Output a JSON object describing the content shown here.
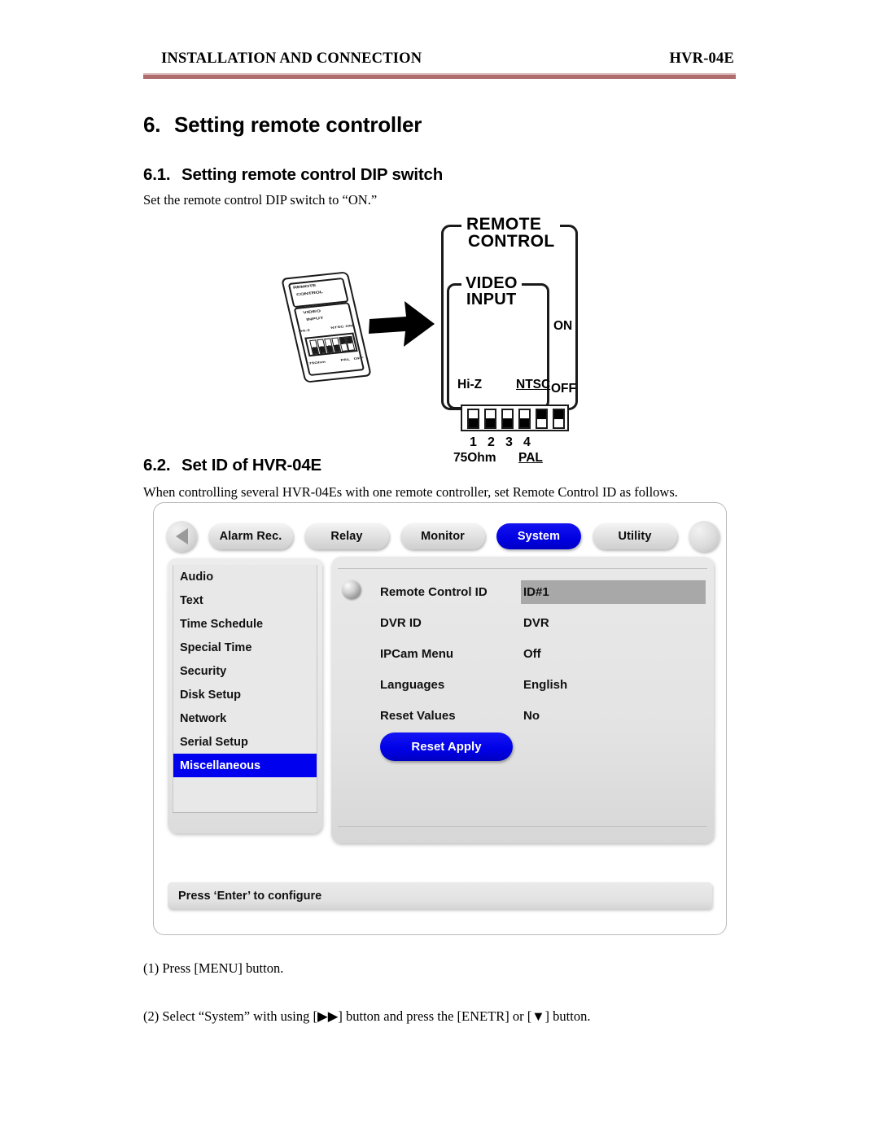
{
  "header": {
    "left": "INSTALLATION AND CONNECTION",
    "right": "HVR-04E",
    "rule_color": "#b06d6d"
  },
  "sections": {
    "s6": {
      "number": "6.",
      "title": "Setting remote controller"
    },
    "s61": {
      "number": "6.1.",
      "title": "Setting remote control DIP switch",
      "body": "Set the remote control DIP switch to “ON.”"
    },
    "s62": {
      "number": "6.2.",
      "title": "Set ID of HVR-04E",
      "body": "When controlling several HVR-04Es with one remote controller, set Remote Control ID as follows."
    }
  },
  "dip_figure": {
    "outer_legend_line1": "REMOTE",
    "outer_legend_line2": "CONTROL",
    "inner_legend_line1": "VIDEO",
    "inner_legend_line2": "INPUT",
    "label_hiz": "Hi-Z",
    "label_ntsc": "NTSC",
    "label_on": "ON",
    "label_off": "OFF",
    "label_75ohm": "75Ohm",
    "label_pal": "PAL",
    "switch_numbers": [
      "1",
      "2",
      "3",
      "4"
    ],
    "switch_states": [
      "off",
      "off",
      "off",
      "off",
      "on",
      "on"
    ],
    "mini_label": {
      "l1": "REMOTE",
      "l2": "CONTROL",
      "l3": "VIDEO",
      "l4": "INPUT",
      "l5": "Hi-Z",
      "l6": "NTSC",
      "l7": "ON",
      "l8": "75Ohm",
      "l9": "PAL",
      "l10": "OFF"
    }
  },
  "osd": {
    "tabs": [
      {
        "label": "Alarm Rec.",
        "active": false
      },
      {
        "label": "Relay",
        "active": false
      },
      {
        "label": "Monitor",
        "active": false
      },
      {
        "label": "System",
        "active": true
      },
      {
        "label": "Utility",
        "active": false
      }
    ],
    "sidebar": [
      {
        "label": "Audio",
        "selected": false
      },
      {
        "label": "Text",
        "selected": false
      },
      {
        "label": "Time Schedule",
        "selected": false
      },
      {
        "label": "Special Time",
        "selected": false
      },
      {
        "label": "Security",
        "selected": false
      },
      {
        "label": "Disk Setup",
        "selected": false
      },
      {
        "label": "Network",
        "selected": false
      },
      {
        "label": "Serial Setup",
        "selected": false
      },
      {
        "label": "Miscellaneous",
        "selected": true
      }
    ],
    "settings": [
      {
        "label": "Remote Control ID",
        "value": "ID#1",
        "highlighted": true
      },
      {
        "label": "DVR ID",
        "value": "DVR",
        "highlighted": false
      },
      {
        "label": "IPCam Menu",
        "value": "Off",
        "highlighted": false
      },
      {
        "label": "Languages",
        "value": "English",
        "highlighted": false
      },
      {
        "label": "Reset Values",
        "value": "No",
        "highlighted": false
      }
    ],
    "reset_button": "Reset Apply",
    "statusbar": "Press ‘Enter’ to configure",
    "accent_color": "#0000ee"
  },
  "steps": [
    "(1) Press [MENU] button.",
    "(2) Select “System” with using [▶▶] button and press the [ENETR] or [▼] button."
  ]
}
